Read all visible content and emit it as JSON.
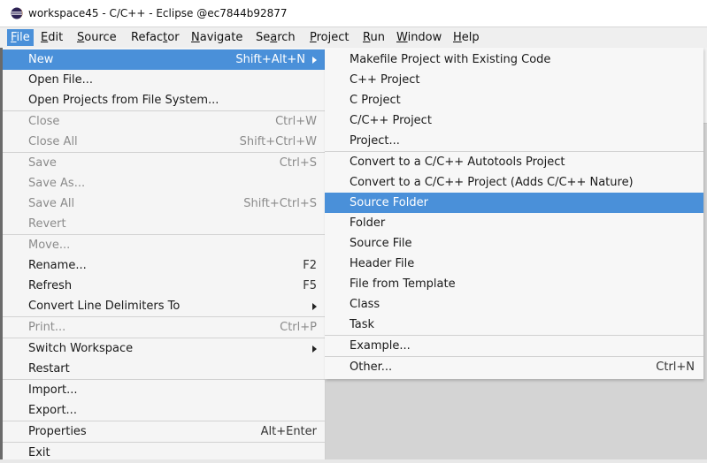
{
  "window": {
    "title": "workspace45 - C/C++ - Eclipse @ec7844b92877"
  },
  "menubar": [
    {
      "label": "File",
      "mnemonic": "F",
      "rest": "ile",
      "active": true
    },
    {
      "label": "Edit",
      "mnemonic": "E",
      "rest": "dit"
    },
    {
      "label": "Source",
      "mnemonic": "S",
      "rest": "ource"
    },
    {
      "label": "Refactor",
      "mnemonic": "t",
      "pre": "Refac",
      "rest": "or"
    },
    {
      "label": "Navigate",
      "mnemonic": "N",
      "rest": "avigate"
    },
    {
      "label": "Search",
      "mnemonic": "a",
      "pre": "Se",
      "rest": "rch"
    },
    {
      "label": "Project",
      "mnemonic": "P",
      "rest": "roject"
    },
    {
      "label": "Run",
      "mnemonic": "R",
      "rest": "un"
    },
    {
      "label": "Window",
      "mnemonic": "W",
      "rest": "indow"
    },
    {
      "label": "Help",
      "mnemonic": "H",
      "rest": "elp"
    }
  ],
  "file_menu": {
    "items": [
      {
        "label": "New",
        "accel": "Shift+Alt+N",
        "submenu": true,
        "highlight": true
      },
      {
        "label": "Open File..."
      },
      {
        "label": "Open Projects from File System..."
      },
      {
        "label": "Close",
        "accel": "Ctrl+W",
        "disabled": true
      },
      {
        "label": "Close All",
        "accel": "Shift+Ctrl+W",
        "disabled": true
      },
      {
        "label": "Save",
        "accel": "Ctrl+S",
        "disabled": true
      },
      {
        "label": "Save As...",
        "disabled": true
      },
      {
        "label": "Save All",
        "accel": "Shift+Ctrl+S",
        "disabled": true
      },
      {
        "label": "Revert",
        "disabled": true
      },
      {
        "label": "Move...",
        "disabled": true
      },
      {
        "label": "Rename...",
        "accel": "F2"
      },
      {
        "label": "Refresh",
        "accel": "F5"
      },
      {
        "label": "Convert Line Delimiters To",
        "submenu": true
      },
      {
        "label": "Print...",
        "accel": "Ctrl+P",
        "disabled": true
      },
      {
        "label": "Switch Workspace",
        "submenu": true
      },
      {
        "label": "Restart"
      },
      {
        "label": "Import..."
      },
      {
        "label": "Export..."
      },
      {
        "label": "Properties",
        "accel": "Alt+Enter"
      },
      {
        "label": "Exit"
      }
    ]
  },
  "new_submenu": {
    "items": [
      {
        "label": "Makefile Project with Existing Code"
      },
      {
        "label": "C++ Project"
      },
      {
        "label": "C Project"
      },
      {
        "label": "C/C++ Project"
      },
      {
        "label": "Project..."
      },
      {
        "label": "Convert to a C/C++ Autotools Project"
      },
      {
        "label": "Convert to a C/C++ Project (Adds C/C++ Nature)"
      },
      {
        "label": "Source Folder",
        "highlight": true
      },
      {
        "label": "Folder"
      },
      {
        "label": "Source File"
      },
      {
        "label": "Header File"
      },
      {
        "label": "File from Template"
      },
      {
        "label": "Class"
      },
      {
        "label": "Task"
      },
      {
        "label": "Example..."
      },
      {
        "label": "Other...",
        "accel": "Ctrl+N"
      }
    ]
  },
  "colors": {
    "highlight": "#4a90d9",
    "disabled_text": "#8b8b8b",
    "menu_bg": "#f5f5f5"
  }
}
